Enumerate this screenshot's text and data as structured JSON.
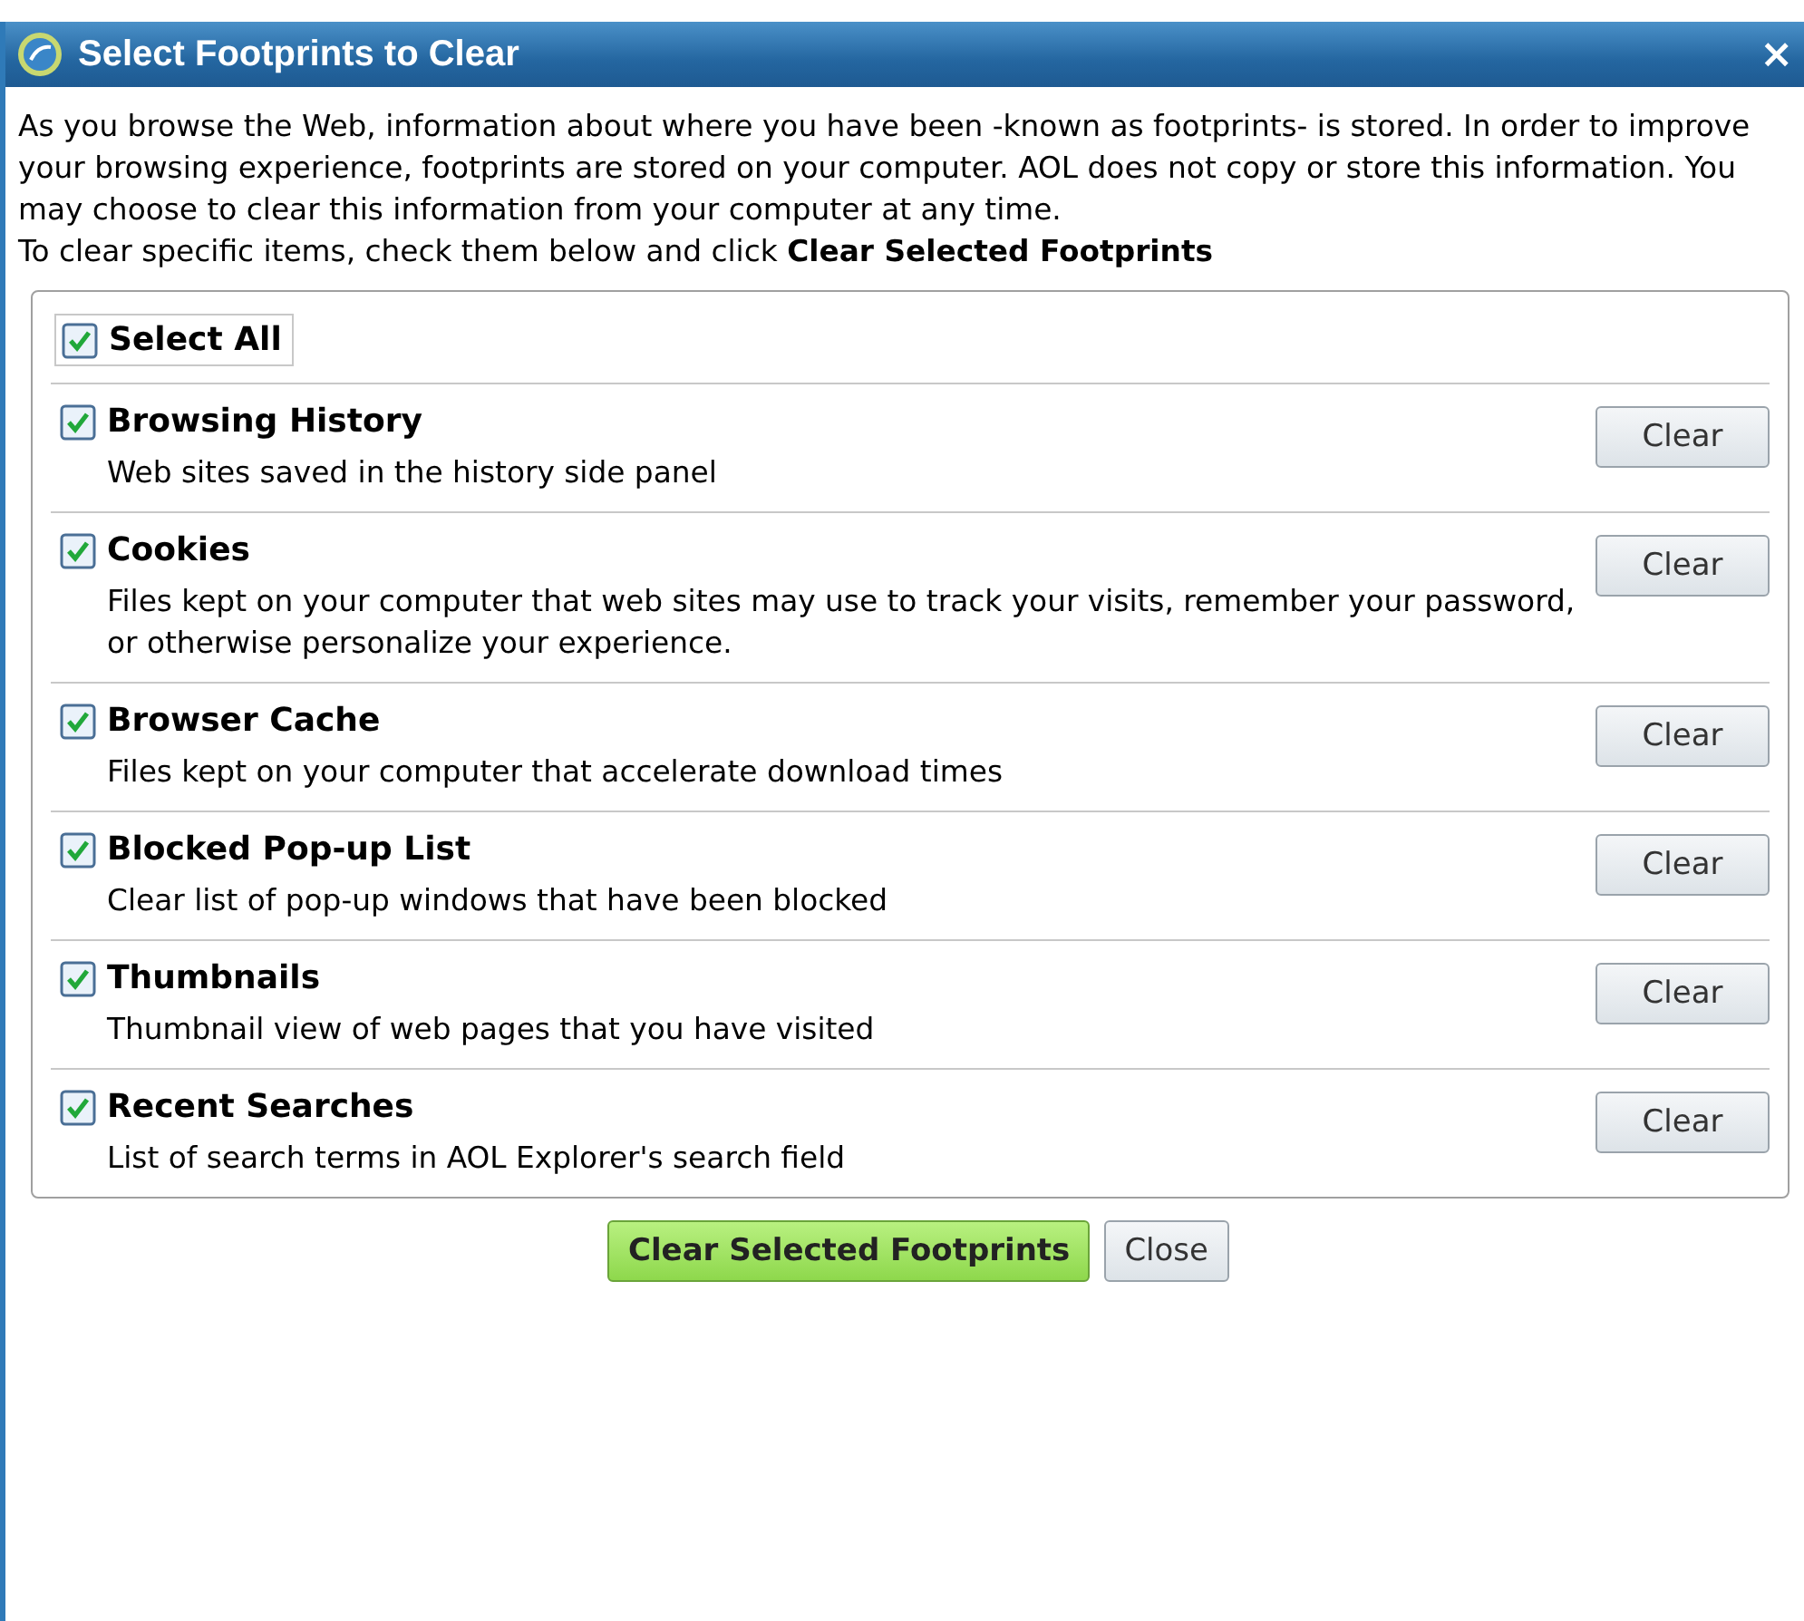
{
  "window": {
    "title": "Select Footprints to Clear",
    "close": "×"
  },
  "intro": "As you browse the Web, information about where you have been -known as footprints- is stored. In order to improve your browsing experience, footprints are stored on your computer. AOL does not copy or store this information. You may choose to clear this information from your computer at any time.",
  "instruction": "To clear specific items, check them below and click **Clear Selected Footprints**",
  "select_all": {
    "label": "Select All",
    "checked": true
  },
  "items": [
    {
      "title": "Browsing History",
      "description": "Web sites saved in the history side panel",
      "checked": true,
      "button": "Clear"
    },
    {
      "title": "Cookies",
      "description": "Files kept on your computer that web sites may use to track your visits, remember your password, or otherwise personalize your experience.",
      "checked": true,
      "button": "Clear"
    },
    {
      "title": "Browser Cache",
      "description": "Files kept on your computer that accelerate download times",
      "checked": true,
      "button": "Clear"
    },
    {
      "title": "Blocked Pop-up List",
      "description": "Clear list of pop-up windows that have been blocked",
      "checked": true,
      "button": "Clear"
    },
    {
      "title": "Thumbnails",
      "description": "Thumbnail view of web pages that you have visited",
      "checked": true,
      "button": "Clear"
    },
    {
      "title": "Recent Searches",
      "description": "List of search terms in AOL Explorer's search field",
      "checked": true,
      "button": "Clear"
    }
  ],
  "buttons": [
    {
      "label": "Clear Selected Footprints",
      "kind": "primary"
    },
    {
      "label": "Close",
      "kind": "secondary"
    }
  ]
}
